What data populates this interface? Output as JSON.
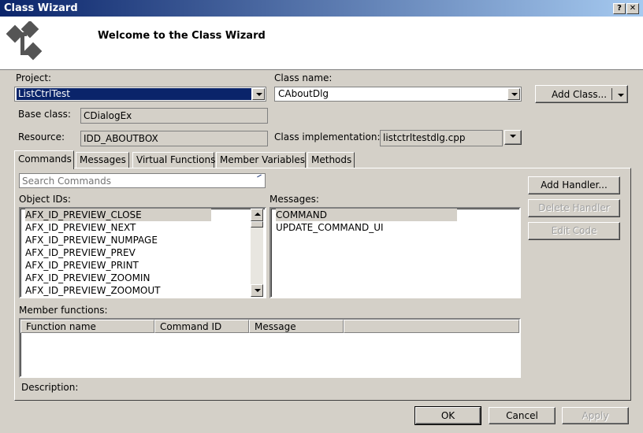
{
  "window": {
    "title": "Class Wizard",
    "help_btn": "?",
    "close_btn": "✕"
  },
  "header": {
    "title": "Welcome to the Class Wizard",
    "icon": "class-wizard-icon"
  },
  "project": {
    "label": "Project:",
    "value": "ListCtrlTest"
  },
  "class_name": {
    "label": "Class name:",
    "value": "CAboutDlg"
  },
  "add_class": {
    "label": "Add Class..."
  },
  "base_class": {
    "label": "Base class:",
    "value": "CDialogEx"
  },
  "resource": {
    "label": "Resource:",
    "value": "IDD_ABOUTBOX"
  },
  "class_impl": {
    "label": "Class implementation:",
    "value": "listctrltestdlg.cpp"
  },
  "tabs": [
    {
      "label": "Commands"
    },
    {
      "label": "Messages"
    },
    {
      "label": "Virtual Functions"
    },
    {
      "label": "Member Variables"
    },
    {
      "label": "Methods"
    }
  ],
  "search": {
    "placeholder": "Search Commands"
  },
  "object_ids": {
    "label": "Object IDs:",
    "items": [
      "AFX_ID_PREVIEW_CLOSE",
      "AFX_ID_PREVIEW_NEXT",
      "AFX_ID_PREVIEW_NUMPAGE",
      "AFX_ID_PREVIEW_PREV",
      "AFX_ID_PREVIEW_PRINT",
      "AFX_ID_PREVIEW_ZOOMIN",
      "AFX_ID_PREVIEW_ZOOMOUT"
    ],
    "selected": "AFX_ID_PREVIEW_CLOSE"
  },
  "messages": {
    "label": "Messages:",
    "items": [
      "COMMAND",
      "UPDATE_COMMAND_UI"
    ],
    "selected": "COMMAND"
  },
  "handlers": {
    "add": "Add Handler...",
    "delete": "Delete Handler",
    "edit": "Edit Code"
  },
  "member_functions": {
    "label": "Member functions:",
    "columns": [
      "Function name",
      "Command ID",
      "Message"
    ]
  },
  "description": {
    "label": "Description:"
  },
  "footer": {
    "ok": "OK",
    "cancel": "Cancel",
    "apply": "Apply"
  }
}
